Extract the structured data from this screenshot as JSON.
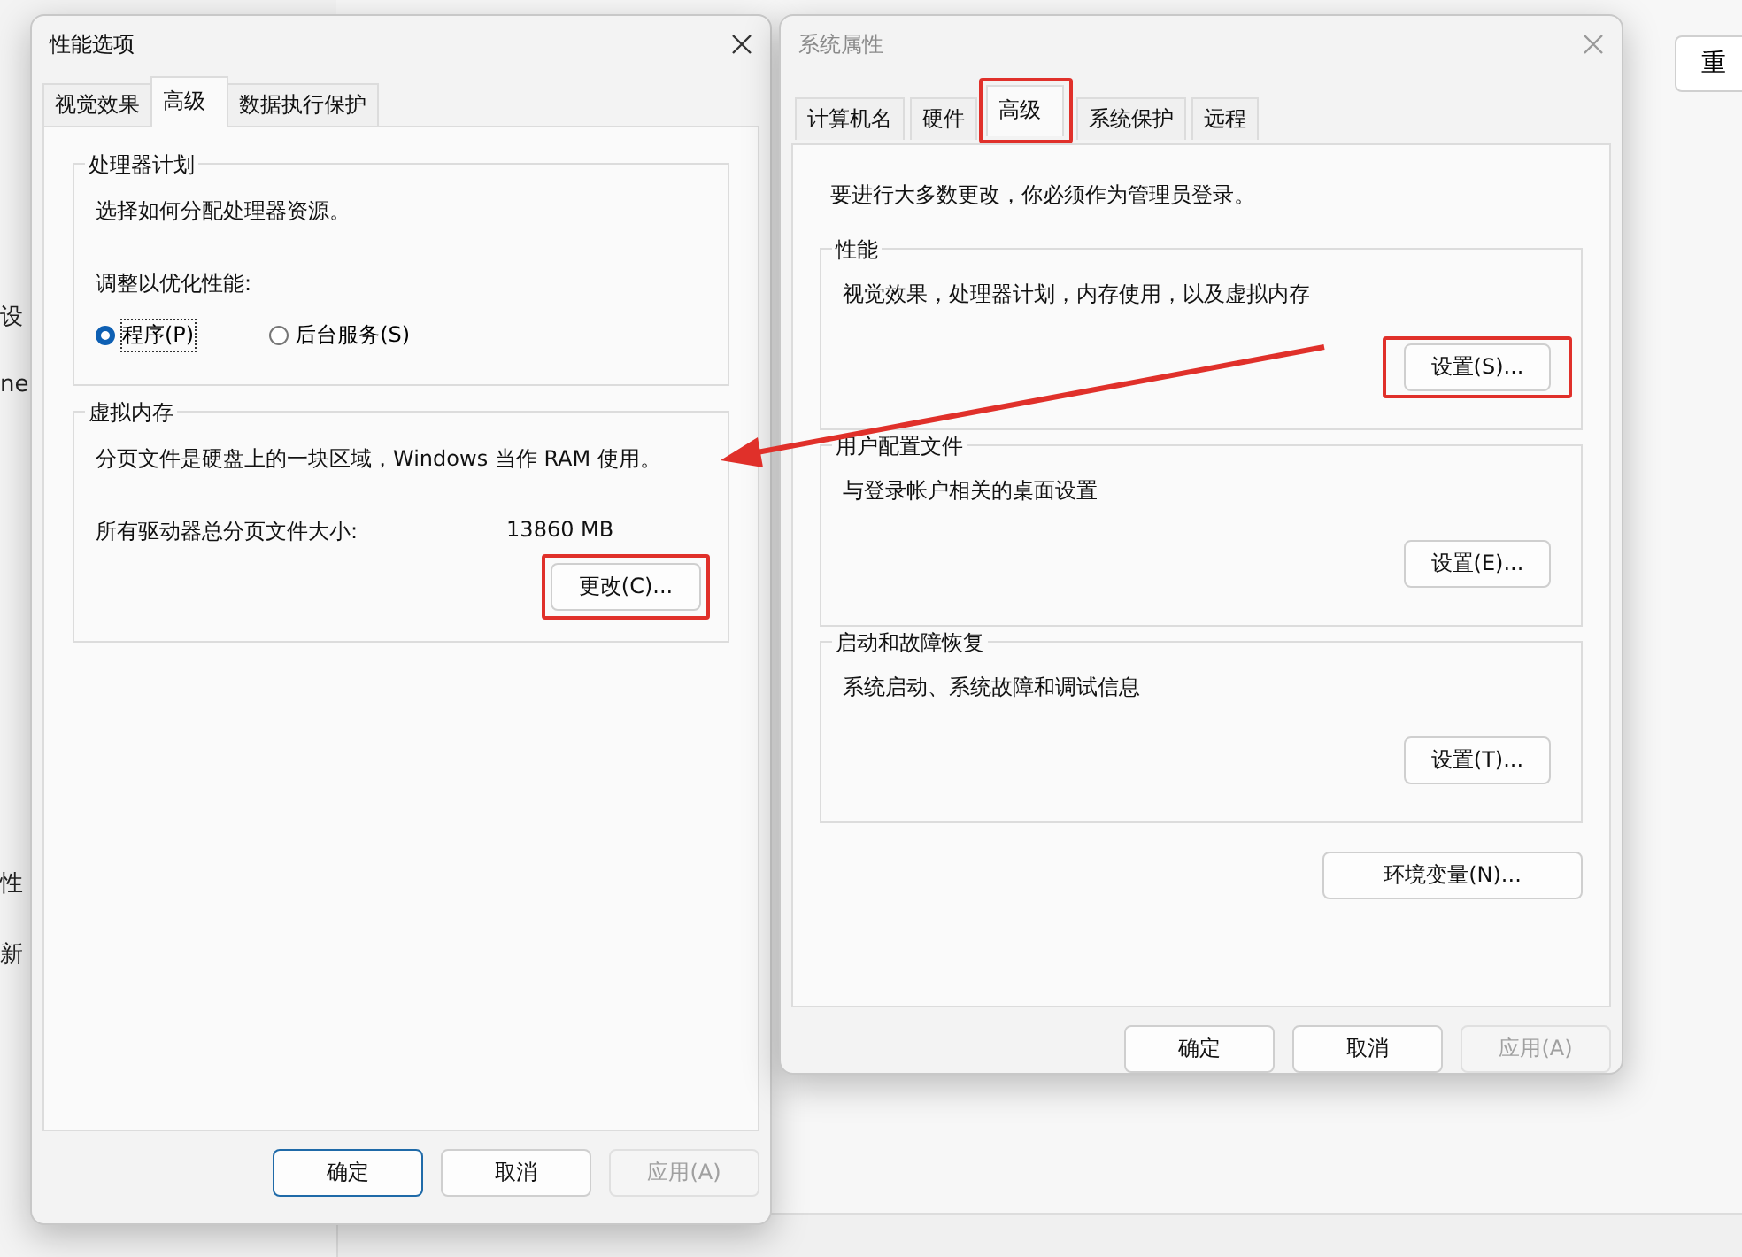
{
  "background": {
    "left_texts": [
      "设",
      "ne",
      "性",
      "新"
    ],
    "right_button": "重"
  },
  "performance_dialog": {
    "title": "性能选项",
    "tabs": [
      {
        "label": "视觉效果",
        "selected": false
      },
      {
        "label": "高级",
        "selected": true
      },
      {
        "label": "数据执行保护",
        "selected": false
      }
    ],
    "processor_group": {
      "title": "处理器计划",
      "description": "选择如何分配处理器资源。",
      "adjust_label": "调整以优化性能:",
      "options": [
        {
          "label": "程序(P)",
          "selected": true
        },
        {
          "label": "后台服务(S)",
          "selected": false
        }
      ]
    },
    "virtual_memory_group": {
      "title": "虚拟内存",
      "description": "分页文件是硬盘上的一块区域，Windows 当作 RAM 使用。",
      "total_label": "所有驱动器总分页文件大小:",
      "total_value": "13860 MB",
      "button": {
        "label": "更改(C)...",
        "highlighted": true
      }
    },
    "buttons": [
      {
        "label": "确定",
        "default": true,
        "disabled": false
      },
      {
        "label": "取消",
        "default": false,
        "disabled": false
      },
      {
        "label": "应用(A)",
        "default": false,
        "disabled": true
      }
    ]
  },
  "system_dialog": {
    "title": "系统属性",
    "tabs": [
      {
        "label": "计算机名",
        "selected": false,
        "highlighted": false
      },
      {
        "label": "硬件",
        "selected": false,
        "highlighted": false
      },
      {
        "label": "高级",
        "selected": true,
        "highlighted": true
      },
      {
        "label": "系统保护",
        "selected": false,
        "highlighted": false
      },
      {
        "label": "远程",
        "selected": false,
        "highlighted": false
      }
    ],
    "admin_note": "要进行大多数更改，你必须作为管理员登录。",
    "groups": [
      {
        "title": "性能",
        "description": "视觉效果，处理器计划，内存使用，以及虚拟内存",
        "button": {
          "label": "设置(S)...",
          "highlighted": true
        }
      },
      {
        "title": "用户配置文件",
        "description": "与登录帐户相关的桌面设置",
        "button": {
          "label": "设置(E)...",
          "highlighted": false
        }
      },
      {
        "title": "启动和故障恢复",
        "description": "系统启动、系统故障和调试信息",
        "button": {
          "label": "设置(T)...",
          "highlighted": false
        }
      }
    ],
    "env_button": "环境变量(N)...",
    "buttons": [
      {
        "label": "确定",
        "default": false,
        "disabled": false
      },
      {
        "label": "取消",
        "default": false,
        "disabled": false
      },
      {
        "label": "应用(A)",
        "default": false,
        "disabled": true
      }
    ]
  }
}
